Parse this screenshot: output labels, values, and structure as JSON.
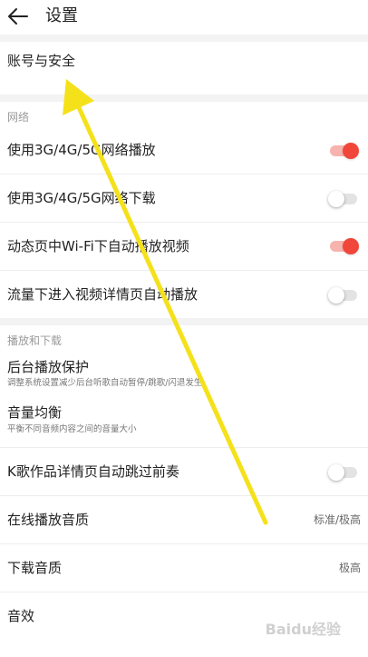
{
  "header": {
    "title": "设置",
    "back_icon": "arrow-left-icon"
  },
  "account": {
    "label": "账号与安全"
  },
  "network": {
    "section_title": "网络",
    "items": [
      {
        "label": "使用3G/4G/5G网络播放",
        "enabled": true
      },
      {
        "label": "使用3G/4G/5G网络下载",
        "enabled": false
      },
      {
        "label": "动态页中Wi-Fi下自动播放视频",
        "enabled": true
      },
      {
        "label": "流量下进入视频详情页自动播放",
        "enabled": false
      }
    ]
  },
  "playback": {
    "section_title": "播放和下载",
    "background_protect": {
      "label": "后台播放保护",
      "desc": "调整系统设置减少后台听歌自动暂停/跳歌/闪退发生"
    },
    "volume_balance": {
      "label": "音量均衡",
      "desc": "平衡不同音频内容之间的音量大小"
    },
    "k_song_skip": {
      "label": "K歌作品详情页自动跳过前奏",
      "enabled": false
    },
    "online_quality": {
      "label": "在线播放音质",
      "value": "标准/极高"
    },
    "download_quality": {
      "label": "下载音质",
      "value": "极高"
    },
    "sound_effect": {
      "label": "音效"
    }
  },
  "watermark": {
    "text": "Baidu经验"
  },
  "colors": {
    "accent": "#f0473a",
    "accent_track": "#f7b3ae",
    "section_gap": "#f3f3f3",
    "annotation_arrow": "#f5e11a"
  }
}
